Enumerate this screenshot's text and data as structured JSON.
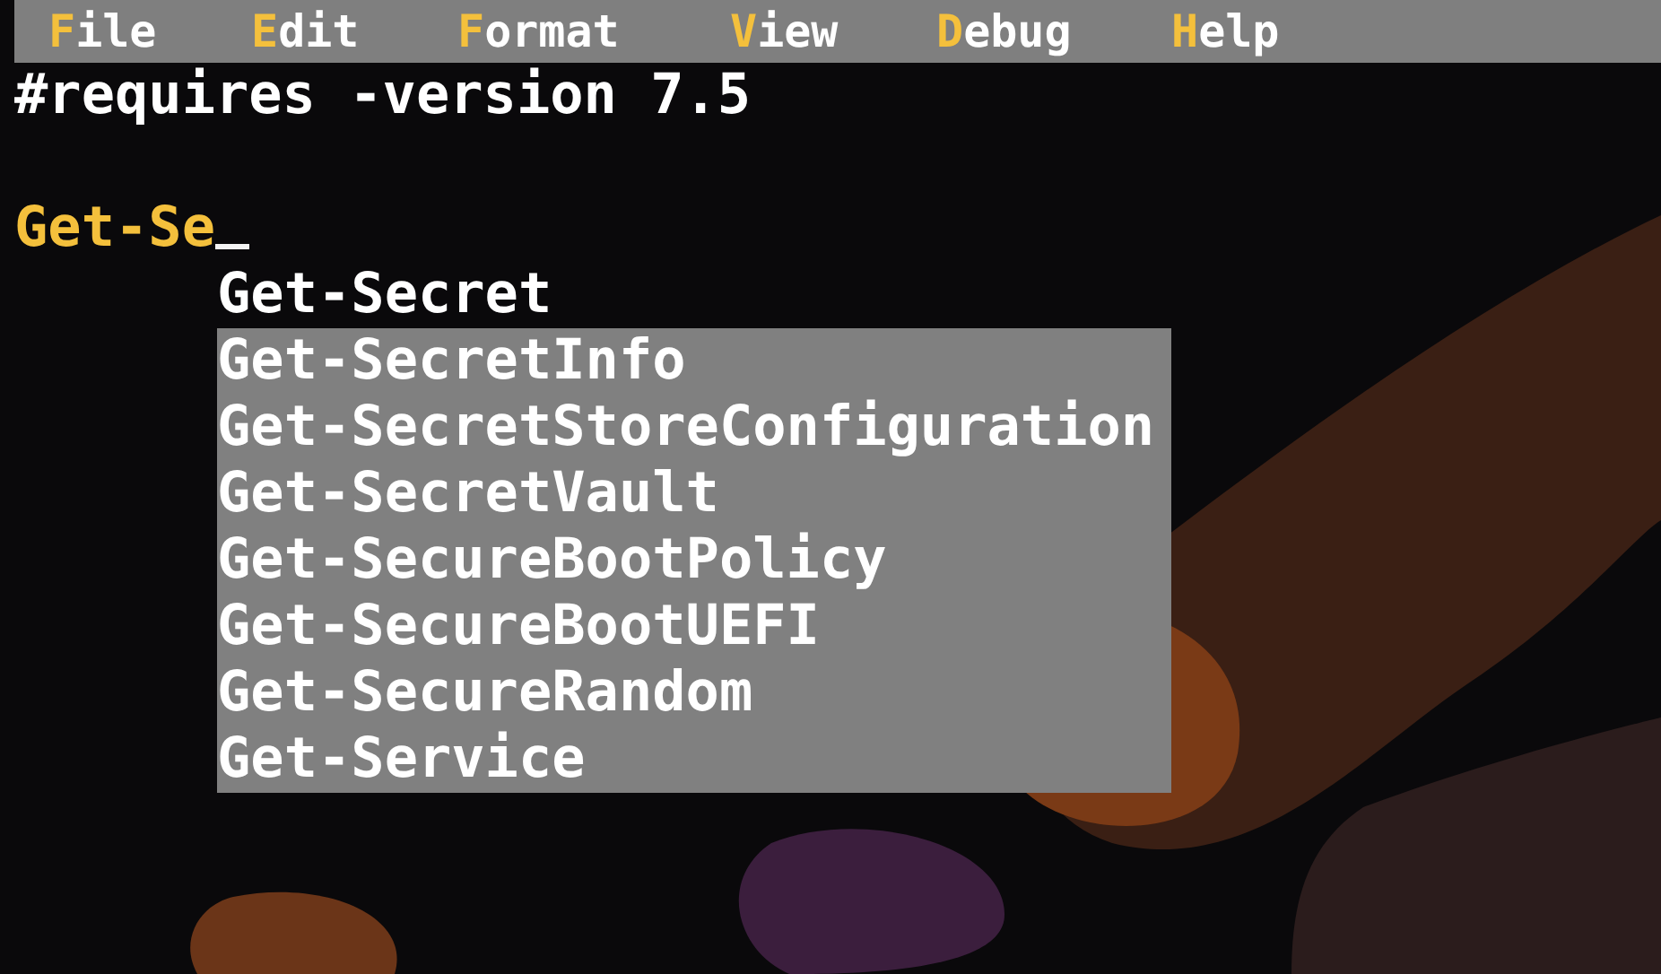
{
  "menu": [
    {
      "label": "File"
    },
    {
      "label": "Edit"
    },
    {
      "label": "Format"
    },
    {
      "label": "View"
    },
    {
      "label": "Debug"
    },
    {
      "label": "Help"
    }
  ],
  "editor": {
    "lines": [
      "#requires -version 7.5"
    ],
    "input": "Get-Se"
  },
  "completions": [
    {
      "label": "Get-Secret",
      "selected": true
    },
    {
      "label": "Get-SecretInfo",
      "selected": false
    },
    {
      "label": "Get-SecretStoreConfiguration",
      "selected": false
    },
    {
      "label": "Get-SecretVault",
      "selected": false
    },
    {
      "label": "Get-SecureBootPolicy",
      "selected": false
    },
    {
      "label": "Get-SecureBootUEFI",
      "selected": false
    },
    {
      "label": "Get-SecureRandom",
      "selected": false
    },
    {
      "label": "Get-Service",
      "selected": false
    }
  ]
}
